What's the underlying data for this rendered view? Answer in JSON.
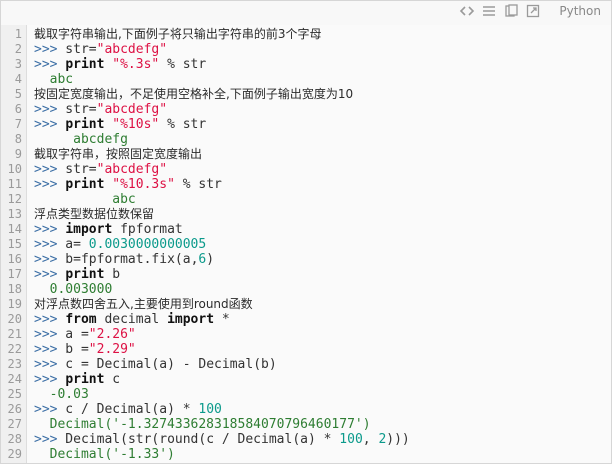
{
  "toolbar": {
    "icons": [
      "code-icon",
      "list-icon",
      "copy-icon",
      "external-icon"
    ],
    "language_label": "Python"
  },
  "editor": {
    "lines": [
      {
        "n": "1",
        "c": "截取字符串输出,下面例子将只输出字符串的前3个字母"
      },
      {
        "n": "2",
        "c": ">>> str=\"abcdefg\""
      },
      {
        "n": "3",
        "c": ">>> print \"%.3s\" % str"
      },
      {
        "n": "4",
        "c": "  abc"
      },
      {
        "n": "5",
        "c": "按固定宽度输出，不足使用空格补全,下面例子输出宽度为10"
      },
      {
        "n": "6",
        "c": ">>> str=\"abcdefg\""
      },
      {
        "n": "7",
        "c": ">>> print \"%10s\" % str"
      },
      {
        "n": "8",
        "c": "     abcdefg"
      },
      {
        "n": "9",
        "c": "截取字符串，按照固定宽度输出"
      },
      {
        "n": "10",
        "c": ">>> str=\"abcdefg\""
      },
      {
        "n": "11",
        "c": ">>> print \"%10.3s\" % str"
      },
      {
        "n": "12",
        "c": "          abc"
      },
      {
        "n": "13",
        "c": "浮点类型数据位数保留"
      },
      {
        "n": "14",
        "c": ">>> import fpformat"
      },
      {
        "n": "15",
        "c": ">>> a= 0.0030000000005"
      },
      {
        "n": "16",
        "c": ">>> b=fpformat.fix(a,6)"
      },
      {
        "n": "17",
        "c": ">>> print b"
      },
      {
        "n": "18",
        "c": "  0.003000"
      },
      {
        "n": "19",
        "c": "对浮点数四舍五入,主要使用到round函数"
      },
      {
        "n": "20",
        "c": ">>> from decimal import *"
      },
      {
        "n": "21",
        "c": ">>> a =\"2.26\""
      },
      {
        "n": "22",
        "c": ">>> b =\"2.29\""
      },
      {
        "n": "23",
        "c": ">>> c = Decimal(a) - Decimal(b)"
      },
      {
        "n": "24",
        "c": ">>> print c"
      },
      {
        "n": "25",
        "c": "  -0.03"
      },
      {
        "n": "26",
        "c": ">>> c / Decimal(a) * 100"
      },
      {
        "n": "27",
        "c": "  Decimal('-1.327433628318584070796460177')"
      },
      {
        "n": "28",
        "c": ">>> Decimal(str(round(c / Decimal(a) * 100, 2)))"
      },
      {
        "n": "29",
        "c": "  Decimal('-1.33')"
      }
    ]
  }
}
